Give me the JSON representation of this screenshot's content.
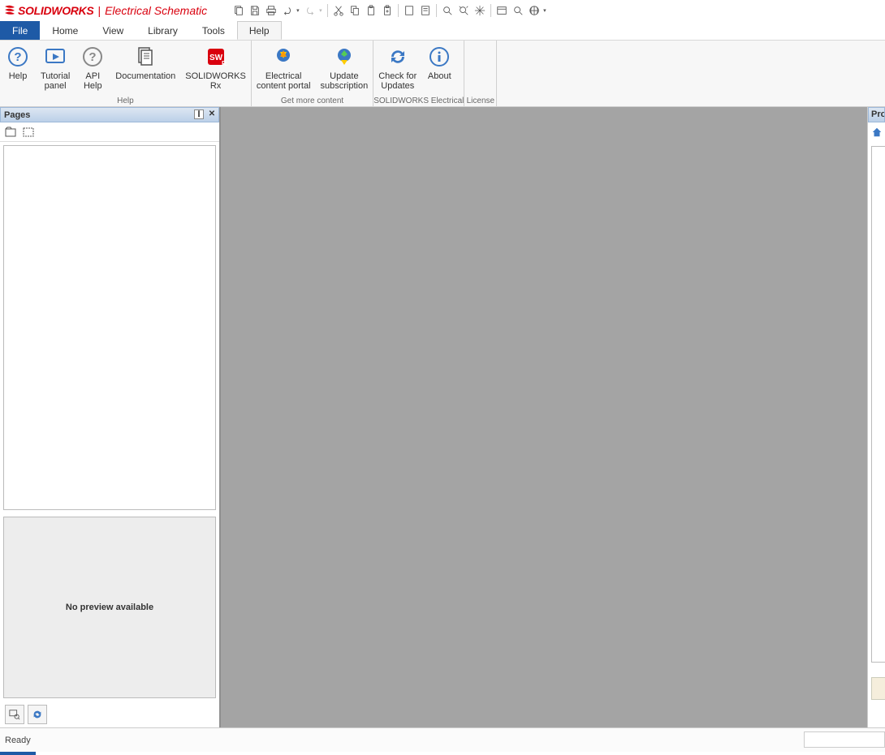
{
  "title": {
    "brand": "SOLIDWORKS",
    "sub": "Electrical Schematic"
  },
  "menu": {
    "file": "File",
    "home": "Home",
    "view": "View",
    "library": "Library",
    "tools": "Tools",
    "help": "Help"
  },
  "ribbon": {
    "help": {
      "caption": "Help",
      "help": "Help",
      "tutorial": "Tutorial\npanel",
      "api": "API\nHelp",
      "doc": "Documentation",
      "rx": "SOLIDWORKS\nRx"
    },
    "content": {
      "caption": "Get more content",
      "portal": "Electrical\ncontent portal",
      "update": "Update\nsubscription"
    },
    "swe": {
      "caption": "SOLIDWORKS Electrical",
      "check": "Check for\nUpdates",
      "about": "About"
    },
    "license": {
      "caption": "License"
    }
  },
  "pages": {
    "title": "Pages",
    "no_preview": "No preview available"
  },
  "right": {
    "title": "Pro"
  },
  "status": {
    "ready": "Ready"
  }
}
